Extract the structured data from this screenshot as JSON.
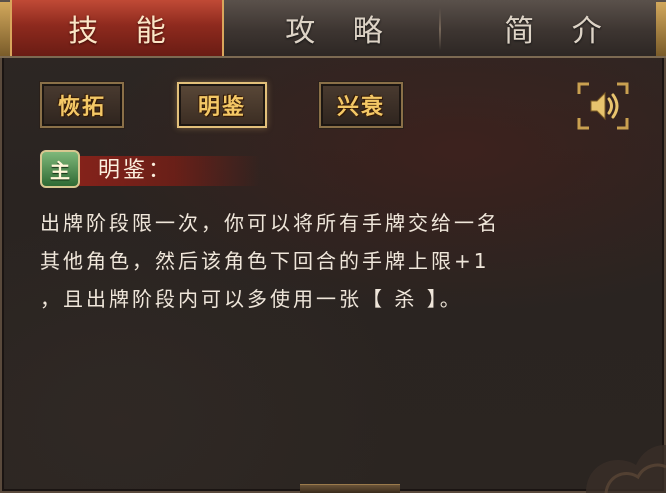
{
  "tabs": [
    {
      "label": "技 能",
      "active": true
    },
    {
      "label": "攻 略",
      "active": false
    },
    {
      "label": "简 介",
      "active": false
    }
  ],
  "skill_buttons": [
    {
      "label": "恢拓",
      "selected": false
    },
    {
      "label": "明鉴",
      "selected": true
    },
    {
      "label": "兴衰",
      "selected": false
    }
  ],
  "sound_icon": "speaker-icon",
  "skill": {
    "badge": "主",
    "name": "明鉴：",
    "description_lines": [
      "出牌阶段限一次，你可以将所有手牌交给一名",
      "其他角色，然后该角色下回合的手牌上限+1",
      "，且出牌阶段内可以多使用一张【 杀 】。"
    ]
  },
  "colors": {
    "accent_gold": "#f4c866",
    "active_tab_red": "#8e2a1e",
    "badge_green": "#2f6a34",
    "text": "#efe6da"
  }
}
